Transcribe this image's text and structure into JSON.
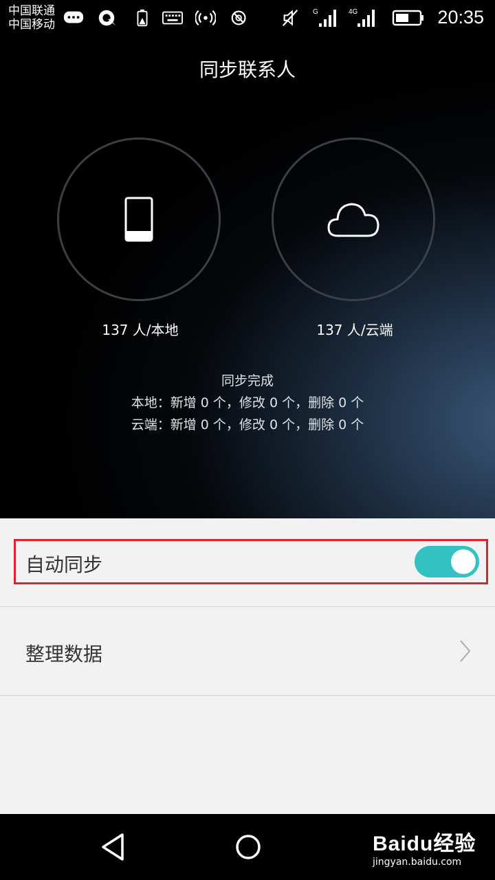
{
  "status_bar": {
    "carrier_1": "中国联通",
    "carrier_2": "中国移动",
    "net_1": "G",
    "net_2": "4G",
    "time": "20:35",
    "icons": [
      "message-icon",
      "qq-icon",
      "battery-warning-icon",
      "keyboard-icon",
      "hotspot-icon",
      "blocked-icon",
      "mute-icon",
      "signal-icon",
      "signal-icon",
      "battery-icon"
    ]
  },
  "header": {
    "title": "同步联系人"
  },
  "summary": {
    "local_count": "137 人/本地",
    "cloud_count": "137 人/云端",
    "sync_status": "同步完成",
    "local_changes": "本地：新增 0 个，修改 0 个，删除 0 个",
    "cloud_changes": "云端：新增 0 个，修改 0 个，删除 0 个"
  },
  "settings": {
    "auto_sync_label": "自动同步",
    "auto_sync_on": true,
    "organize_label": "整理数据"
  },
  "watermark": {
    "logo": "Baidu经验",
    "url": "jingyan.baidu.com"
  },
  "colors": {
    "toggle_on": "#33c1c4",
    "highlight": "#e0202e",
    "list_bg": "#f2f2f2"
  }
}
